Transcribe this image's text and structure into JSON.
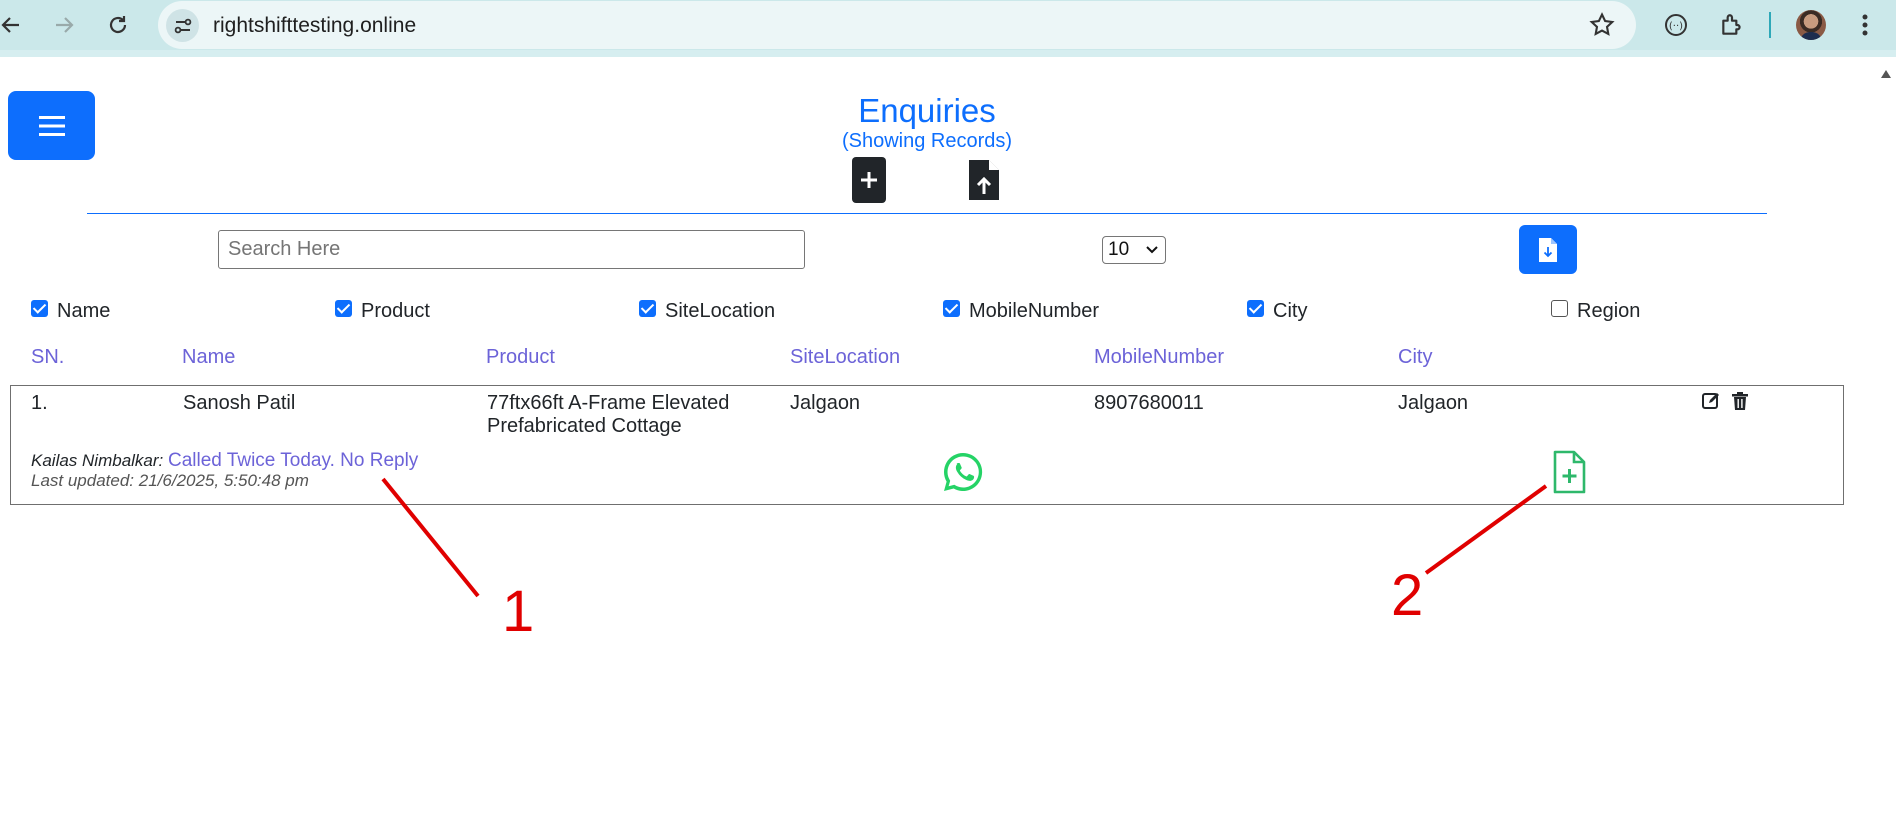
{
  "browser": {
    "url": "rightshifttesting.online"
  },
  "page": {
    "title": "Enquiries",
    "subtitle": "(Showing Records)",
    "search_placeholder": "Search Here",
    "page_size": "10"
  },
  "column_toggles": [
    {
      "label": "Name",
      "checked": true
    },
    {
      "label": "Product",
      "checked": true
    },
    {
      "label": "SiteLocation",
      "checked": true
    },
    {
      "label": "MobileNumber",
      "checked": true
    },
    {
      "label": "City",
      "checked": true
    },
    {
      "label": "Region",
      "checked": false
    }
  ],
  "table": {
    "headers": [
      "SN.",
      "Name",
      "Product",
      "SiteLocation",
      "MobileNumber",
      "City"
    ],
    "rows": [
      {
        "sn": "1.",
        "name": "Sanosh Patil",
        "product_line1": "77ftx66ft A-Frame Elevated",
        "product_line2": "Prefabricated Cottage",
        "site_location": "Jalgaon",
        "mobile": "8907680011",
        "city": "Jalgaon",
        "note_author": "Kailas Nimbalkar:",
        "note_text": "Called Twice Today. No Reply",
        "last_updated": "Last updated: 21/6/2025, 5:50:48 pm"
      }
    ]
  },
  "annotations": {
    "label_1": "1",
    "label_2": "2",
    "color": "#e00000"
  },
  "colors": {
    "primary": "#0d6efd",
    "header_text": "#6c63d8",
    "whatsapp": "#25d366",
    "chrome": "#cbe8ea"
  }
}
